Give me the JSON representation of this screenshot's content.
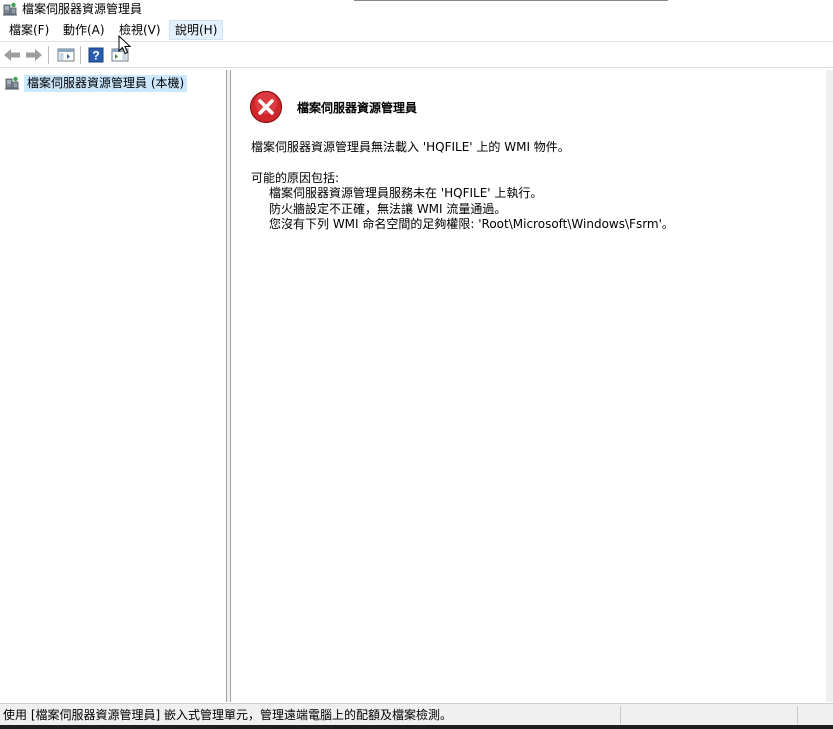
{
  "window": {
    "title": "檔案伺服器資源管理員",
    "app_icon": "server-manager-icon"
  },
  "menu": {
    "items": [
      {
        "label": "檔案(F)"
      },
      {
        "label": "動作(A)"
      },
      {
        "label": "檢視(V)"
      },
      {
        "label": "說明(H)"
      }
    ],
    "active_index": 3
  },
  "toolbar": {
    "buttons": [
      "back-arrow-icon",
      "forward-arrow-icon",
      "show-console-tree-icon",
      "help-icon",
      "show-action-pane-icon"
    ]
  },
  "tree": {
    "root_label": "檔案伺服器資源管理員 (本機)",
    "root_icon": "server-manager-icon"
  },
  "content": {
    "error_title": "檔案伺服器資源管理員",
    "error_message": "檔案伺服器資源管理員無法載入 'HQFILE' 上的 WMI 物件。",
    "reasons_header": "可能的原因包括:",
    "reasons": [
      "檔案伺服器資源管理員服務未在 'HQFILE' 上執行。",
      "防火牆設定不正確，無法讓 WMI 流量通過。",
      "您沒有下列 WMI 命名空間的足夠權限: 'Root\\Microsoft\\Windows\\Fsrm'。"
    ]
  },
  "status": {
    "text": "使用 [檔案伺服器資源管理員] 嵌入式管理單元，管理遠端電腦上的配額及檔案檢測。"
  },
  "colors": {
    "selection": "#cce8ff",
    "menu_hover": "#e5f1fb",
    "error_red": "#d0262b",
    "help_blue": "#2a5db0"
  }
}
